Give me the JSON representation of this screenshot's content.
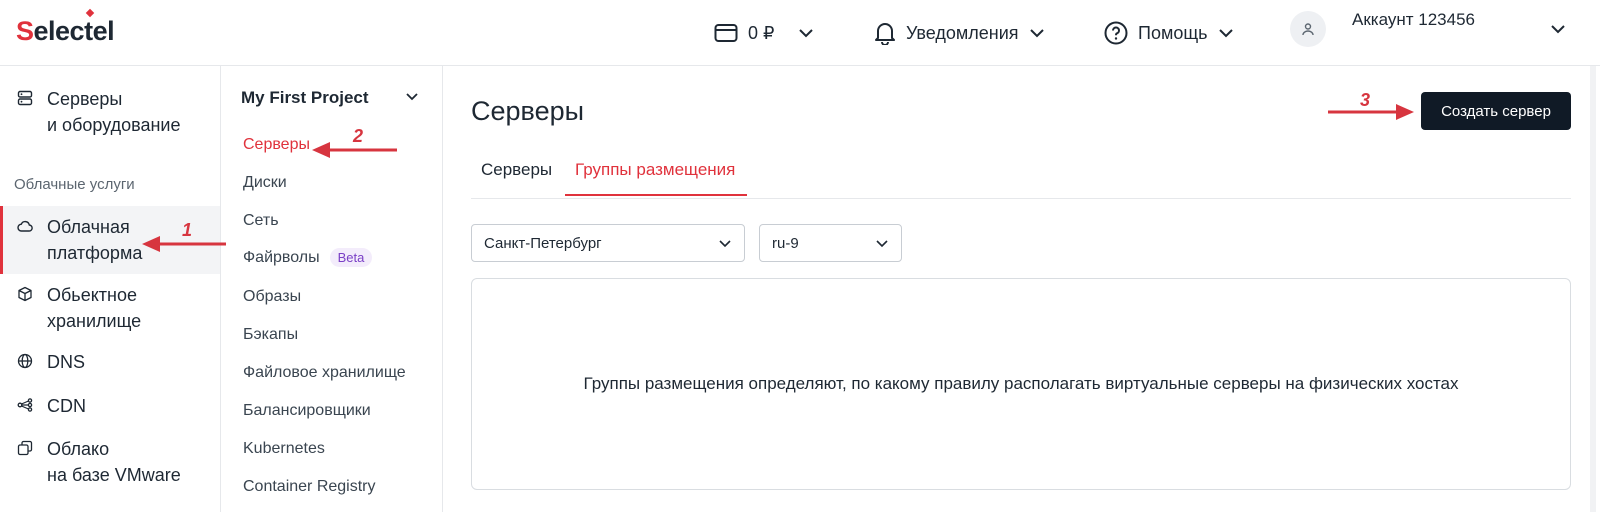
{
  "header": {
    "logo": {
      "prefix": "S",
      "middle": "elec",
      "t": "t",
      "suffix": "el"
    },
    "balance": "0 ₽",
    "notifications": "Уведомления",
    "help": "Помощь",
    "account": "Аккаунт 123456"
  },
  "sidebar": {
    "items": [
      {
        "line1": "Серверы",
        "line2": "и оборудование",
        "icon": "server-icon"
      },
      {
        "line1": "Облачная",
        "line2": "платформа",
        "icon": "cloud-icon"
      },
      {
        "line1": "Обьектное",
        "line2": "хранилище",
        "icon": "box-icon"
      },
      {
        "line1": "DNS",
        "icon": "globe-icon"
      },
      {
        "line1": "CDN",
        "icon": "network-icon"
      },
      {
        "line1": "Облако",
        "line2": "на базе VMware",
        "icon": "vmware-icon"
      }
    ],
    "section_label": "Облачные услуги"
  },
  "subnav": {
    "project": "My First Project",
    "items": [
      "Серверы",
      "Диски",
      "Сеть",
      "Файрволы",
      "Образы",
      "Бэкапы",
      "Файловое хранилище",
      "Балансировщики",
      "Kubernetes",
      "Container Registry"
    ],
    "beta_badge": "Beta"
  },
  "main": {
    "title": "Серверы",
    "create_button": "Создать сервер",
    "tabs": [
      "Серверы",
      "Группы размещения"
    ],
    "region_select": "Санкт-Петербург",
    "pool_select": "ru-9",
    "empty_text": "Группы размещения определяют, по какому правилу располагать виртуальные серверы на физических хостах"
  },
  "annotations": [
    "1",
    "2",
    "3"
  ],
  "colors": {
    "accent": "#e0323c",
    "button": "#101a26",
    "annotation": "#d7353f"
  }
}
